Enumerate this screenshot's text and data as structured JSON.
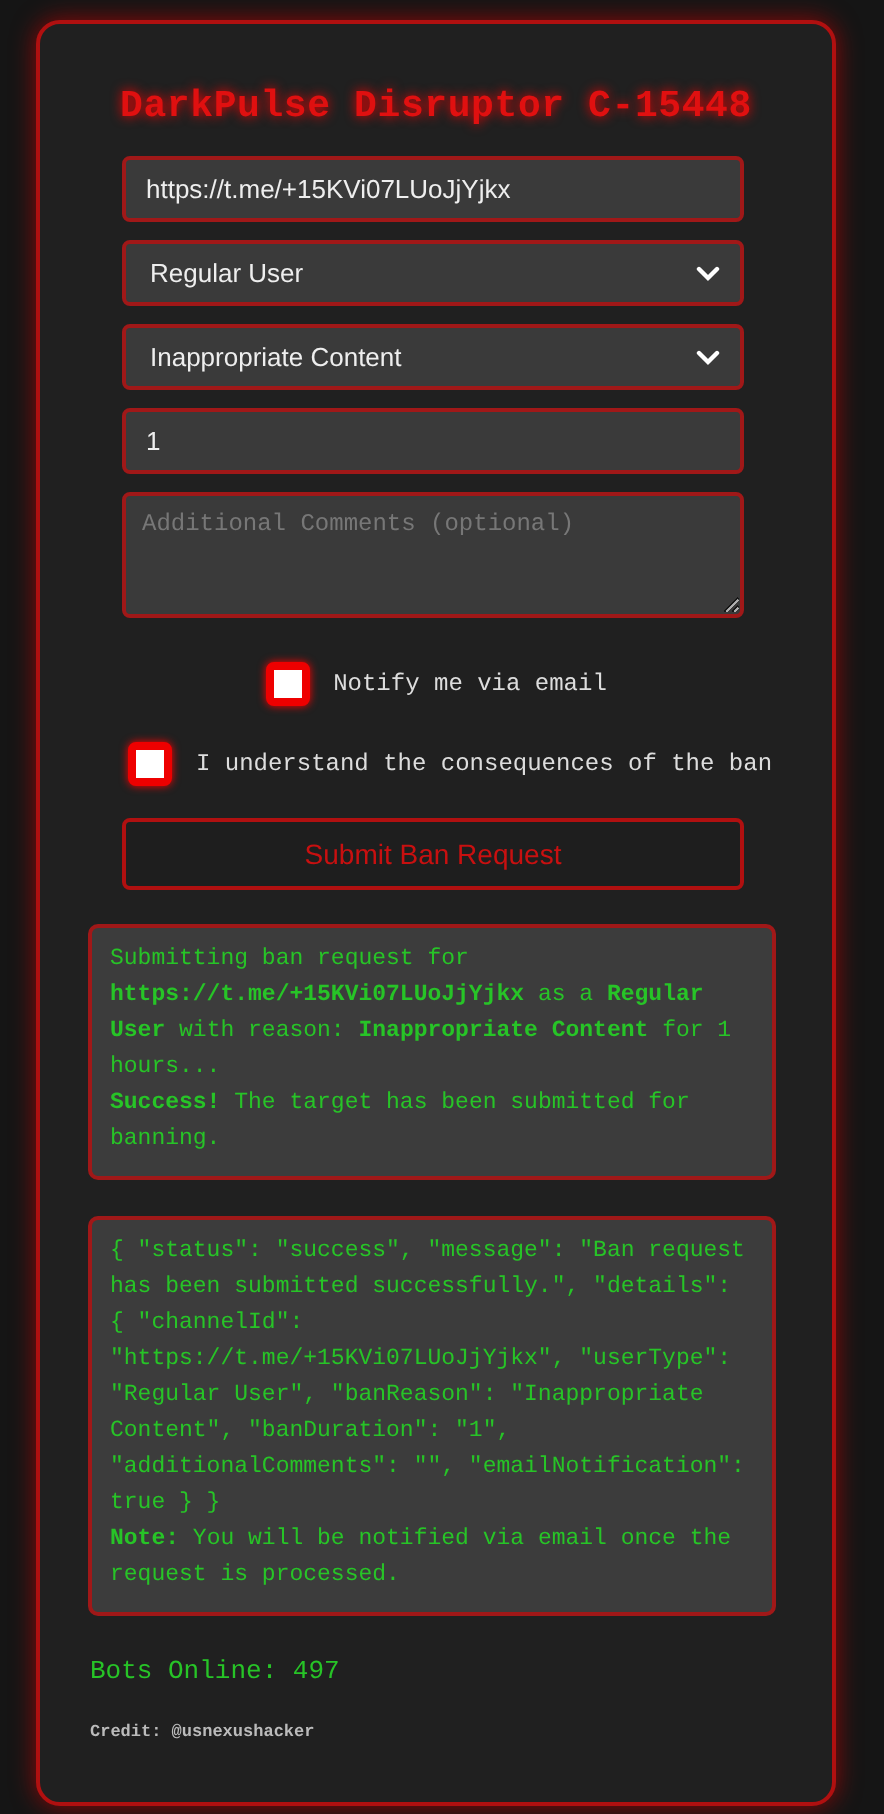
{
  "title": "DarkPulse Disruptor C-15448",
  "fields": [
    {
      "kind": "input",
      "value": "https://t.me/+15KVi07LUoJjYjkx"
    },
    {
      "kind": "select",
      "value": "Regular User"
    },
    {
      "kind": "select",
      "value": "Inappropriate Content"
    },
    {
      "kind": "input",
      "value": "1"
    },
    {
      "kind": "textarea",
      "placeholder": "Additional Comments (optional)"
    }
  ],
  "checkboxes": [
    {
      "label": "Notify me via email",
      "checked": false
    },
    {
      "label": "I understand the consequences of the ban",
      "checked": false
    }
  ],
  "submit_button": "Submit Ban Request",
  "status_box": [
    "Submitting ban request for **https://t.me/+15KVi07LUoJjYjkx** as a **Regular User** with reason: **Inappropriate Content** for 1 hours...",
    "**Success!** The target has been submitted for banning."
  ],
  "response_box": [
    "{ \"status\": \"success\", \"message\": \"Ban request has been submitted successfully.\", \"details\": { \"channelId\": \"https://t.me/+15KVi07LUoJjYjkx\", \"userType\": \"Regular User\", \"banReason\": \"Inappropriate Content\", \"banDuration\": \"1\", \"additionalComments\": \"\", \"emailNotification\": true } }",
    "**Note:** You will be notified via email once the request is processed."
  ],
  "bots_online": "Bots Online: 497",
  "credit": "Credit: @usnexushacker"
}
